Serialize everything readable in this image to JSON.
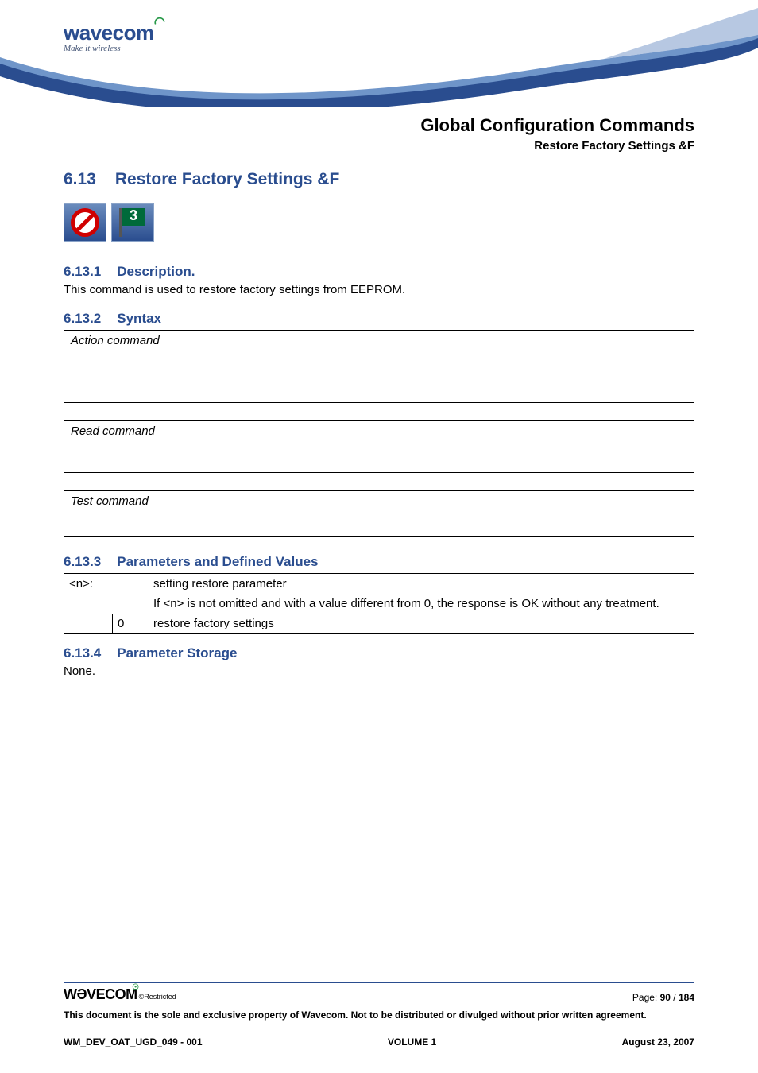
{
  "brand": {
    "name": "wavecom",
    "tagline": "Make it wireless"
  },
  "page_header": {
    "chapter": "Global Configuration Commands",
    "section_name": "Restore Factory Settings &F"
  },
  "section": {
    "number": "6.13",
    "title": "Restore Factory Settings &F"
  },
  "icons": {
    "flag_number": "3"
  },
  "sub": {
    "desc_num": "6.13.1",
    "desc_title": "Description.",
    "desc_body": "This command is used to restore factory settings from EEPROM.",
    "syntax_num": "6.13.2",
    "syntax_title": "Syntax",
    "action_label": "Action command",
    "read_label": "Read command",
    "test_label": "Test command",
    "params_num": "6.13.3",
    "params_title": "Parameters and Defined Values",
    "storage_num": "6.13.4",
    "storage_title": "Parameter Storage",
    "storage_body": "None."
  },
  "param_table": {
    "name": "<n>:",
    "desc1": "setting restore parameter",
    "desc2": "If <n> is not omitted and with a value different from 0, the response is OK without any treatment.",
    "val0": "0",
    "val0_desc": "restore factory settings"
  },
  "footer": {
    "logo": "WƏVECOM",
    "restricted": "©Restricted",
    "page_label": "Page: ",
    "page_current": "90",
    "page_sep": " / ",
    "page_total": "184",
    "legal": "This document is the sole and exclusive property of Wavecom. Not to be distributed or divulged without prior written agreement.",
    "doc_id": "WM_DEV_OAT_UGD_049 - 001",
    "volume": "VOLUME 1",
    "date": "August 23, 2007"
  }
}
